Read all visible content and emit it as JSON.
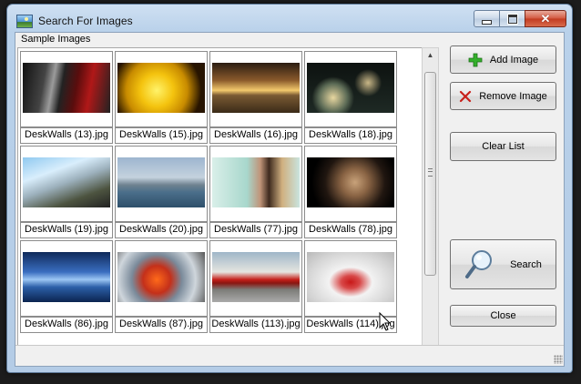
{
  "window": {
    "title": "Search For Images",
    "caption_buttons": [
      "minimize",
      "maximize",
      "close"
    ]
  },
  "gallery": {
    "group_label": "Sample Images",
    "items": [
      {
        "label": "DeskWalls (13).jpg"
      },
      {
        "label": "DeskWalls (15).jpg"
      },
      {
        "label": "DeskWalls (16).jpg"
      },
      {
        "label": "DeskWalls (18).jpg"
      },
      {
        "label": "DeskWalls (19).jpg"
      },
      {
        "label": "DeskWalls (20).jpg"
      },
      {
        "label": "DeskWalls (77).jpg"
      },
      {
        "label": "DeskWalls (78).jpg"
      },
      {
        "label": "DeskWalls (86).jpg"
      },
      {
        "label": "DeskWalls (87).jpg"
      },
      {
        "label": "DeskWalls (113).jpg"
      },
      {
        "label": "DeskWalls (114).jpg"
      }
    ]
  },
  "buttons": {
    "add": {
      "label": "Add Image",
      "icon": "plus-icon",
      "color": "#2fa82b"
    },
    "remove": {
      "label": "Remove Image",
      "icon": "x-icon",
      "color": "#c8201a"
    },
    "clear": {
      "label": "Clear List"
    },
    "search": {
      "label": "Search",
      "icon": "magnifier-icon"
    },
    "close": {
      "label": "Close"
    }
  },
  "colors": {
    "title_bar": "#b9d1ea",
    "client_bg": "#f0f0f0",
    "close_button": "#c23a20"
  }
}
